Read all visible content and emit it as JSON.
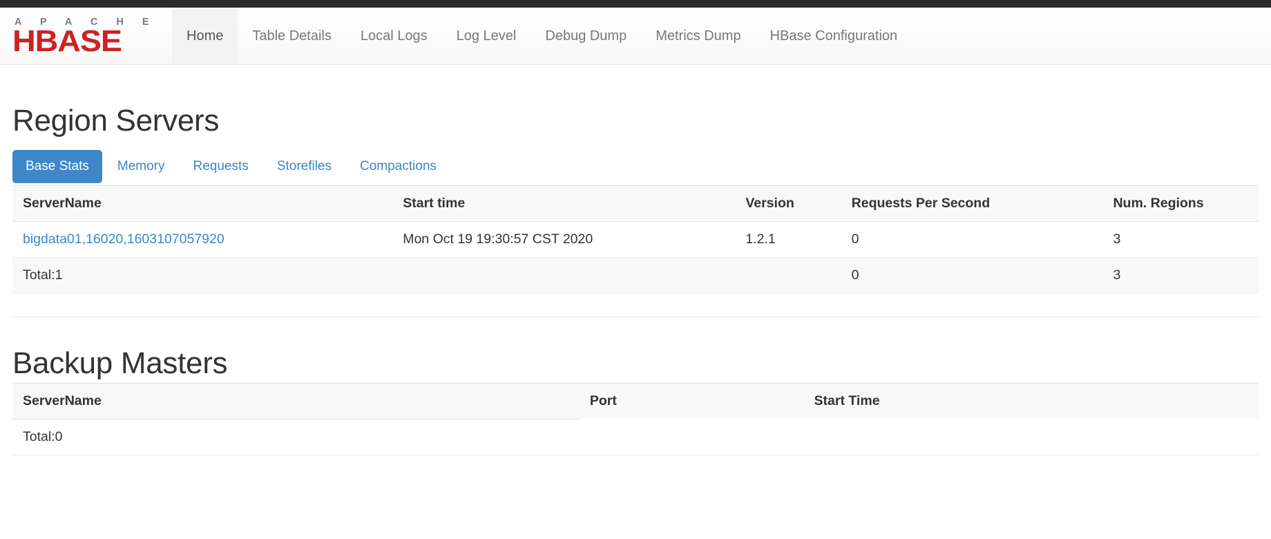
{
  "navbar": {
    "brand": {
      "apache_text": "A P A C H E",
      "hbase_text": "HBASE"
    },
    "items": [
      {
        "label": "Home",
        "active": true
      },
      {
        "label": "Table Details",
        "active": false
      },
      {
        "label": "Local Logs",
        "active": false
      },
      {
        "label": "Log Level",
        "active": false
      },
      {
        "label": "Debug Dump",
        "active": false
      },
      {
        "label": "Metrics Dump",
        "active": false
      },
      {
        "label": "HBase Configuration",
        "active": false
      }
    ]
  },
  "colors": {
    "accent_blue": "#3f87c8",
    "link_blue": "#3a87c8",
    "brand_red": "#cc2222",
    "header_bg": "#f8f8f8"
  },
  "region_servers": {
    "title": "Region Servers",
    "tabs": [
      {
        "label": "Base Stats",
        "active": true
      },
      {
        "label": "Memory",
        "active": false
      },
      {
        "label": "Requests",
        "active": false
      },
      {
        "label": "Storefiles",
        "active": false
      },
      {
        "label": "Compactions",
        "active": false
      }
    ],
    "columns": [
      "ServerName",
      "Start time",
      "Version",
      "Requests Per Second",
      "Num. Regions"
    ],
    "rows": [
      {
        "server_name": "bigdata01,16020,1603107057920",
        "start_time": "Mon Oct 19 19:30:57 CST 2020",
        "version": "1.2.1",
        "requests_per_second": "0",
        "num_regions": "3"
      }
    ],
    "total_row": {
      "label": "Total:1",
      "start_time": "",
      "version": "",
      "requests_per_second": "0",
      "num_regions": "3"
    }
  },
  "backup_masters": {
    "title": "Backup Masters",
    "columns": [
      "ServerName",
      "Port",
      "Start Time"
    ],
    "rows": [],
    "total_row": {
      "label": "Total:0",
      "port": "",
      "start_time": ""
    }
  }
}
